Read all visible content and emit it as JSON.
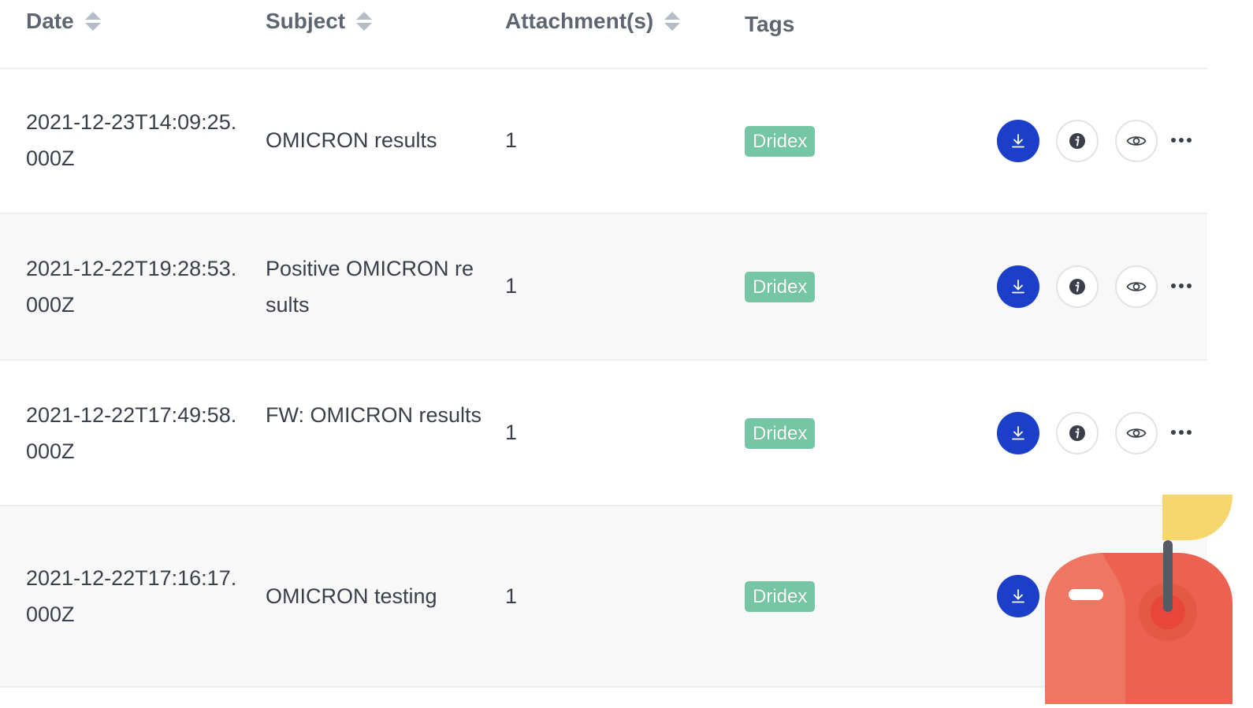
{
  "columns": {
    "date": "Date",
    "subject": "Subject",
    "attachments": "Attachment(s)",
    "tags": "Tags"
  },
  "rows": [
    {
      "date": "2021-12-23T14:09:25.000Z",
      "subject": "OMICRON results",
      "attachments": "1",
      "tag": "Dridex"
    },
    {
      "date": "2021-12-22T19:28:53.000Z",
      "subject": "Positive OMICRON results",
      "attachments": "1",
      "tag": "Dridex"
    },
    {
      "date": "2021-12-22T17:49:58.000Z",
      "subject": "FW: OMICRON results",
      "attachments": "1",
      "tag": "Dridex"
    },
    {
      "date": "2021-12-22T17:16:17.000Z",
      "subject": "OMICRON testing",
      "attachments": "1",
      "tag": "Dridex"
    }
  ],
  "colors": {
    "download_button": "#1c3fc9",
    "tag_background": "#74c6a5",
    "mailbox_body": "#ec6150",
    "mailbox_flag": "#f5d76e"
  },
  "icons": {
    "download": "download-icon",
    "info": "info-icon",
    "preview": "eye-icon",
    "more": "more-icon",
    "sort": "sort-icon"
  }
}
